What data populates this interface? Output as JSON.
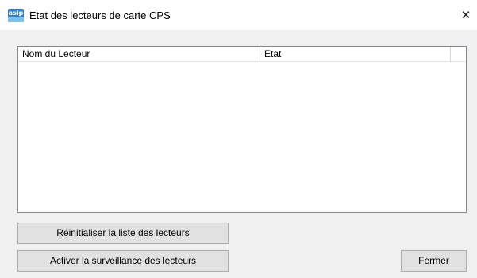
{
  "window": {
    "title": "Etat des lecteurs de carte CPS",
    "icon": "asip-app-icon",
    "icon_text": "asip",
    "close_glyph": "✕"
  },
  "reader_list": {
    "columns": [
      {
        "label": "Nom du Lecteur"
      },
      {
        "label": "Etat"
      }
    ],
    "rows": []
  },
  "buttons": {
    "reset_list": "Réinitialiser la liste des lecteurs",
    "enable_monitoring": "Activer la surveillance des lecteurs",
    "close": "Fermer"
  },
  "colors": {
    "accent": "#2f7ec6",
    "button_face": "#e1e1e1",
    "window_background": "#f0f0f0"
  }
}
